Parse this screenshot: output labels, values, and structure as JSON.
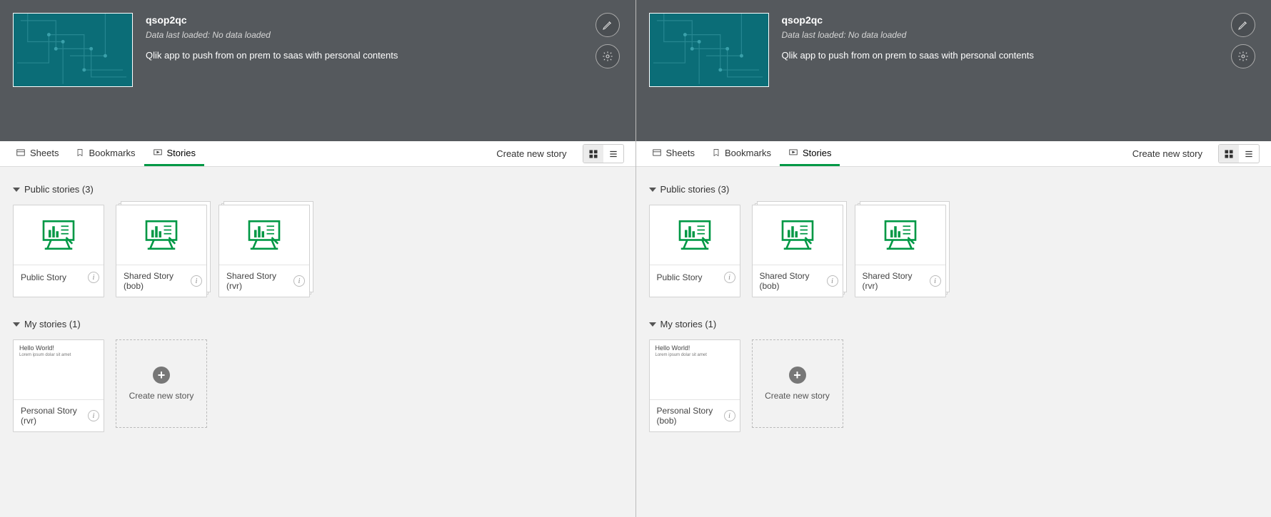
{
  "panels": [
    {
      "header": {
        "title": "qsop2qc",
        "meta": "Data last loaded: No data loaded",
        "desc": "Qlik app to push from on prem to saas with personal contents"
      },
      "tabs": {
        "sheets": "Sheets",
        "bookmarks": "Bookmarks",
        "stories": "Stories",
        "create": "Create new story"
      },
      "sections": {
        "public": {
          "header": "Public stories (3)",
          "items": [
            {
              "label": "Public Story"
            },
            {
              "label": "Shared Story (bob)"
            },
            {
              "label": "Shared Story (rvr)"
            }
          ]
        },
        "mine": {
          "header": "My stories (1)",
          "item": {
            "label": "Personal Story (rvr)",
            "thumb_t1": "Hello World!",
            "thumb_t2": "Lorem ipsum dolar sit amet"
          },
          "add_label": "Create new story"
        }
      }
    },
    {
      "header": {
        "title": "qsop2qc",
        "meta": "Data last loaded: No data loaded",
        "desc": "Qlik app to push from on prem to saas with personal contents"
      },
      "tabs": {
        "sheets": "Sheets",
        "bookmarks": "Bookmarks",
        "stories": "Stories",
        "create": "Create new story"
      },
      "sections": {
        "public": {
          "header": "Public stories (3)",
          "items": [
            {
              "label": "Public Story"
            },
            {
              "label": "Shared Story (bob)"
            },
            {
              "label": "Shared Story (rvr)"
            }
          ]
        },
        "mine": {
          "header": "My stories (1)",
          "item": {
            "label": "Personal Story (bob)",
            "thumb_t1": "Hello World!",
            "thumb_t2": "Lorem ipsum dolar sit amet"
          },
          "add_label": "Create new story"
        }
      }
    }
  ]
}
